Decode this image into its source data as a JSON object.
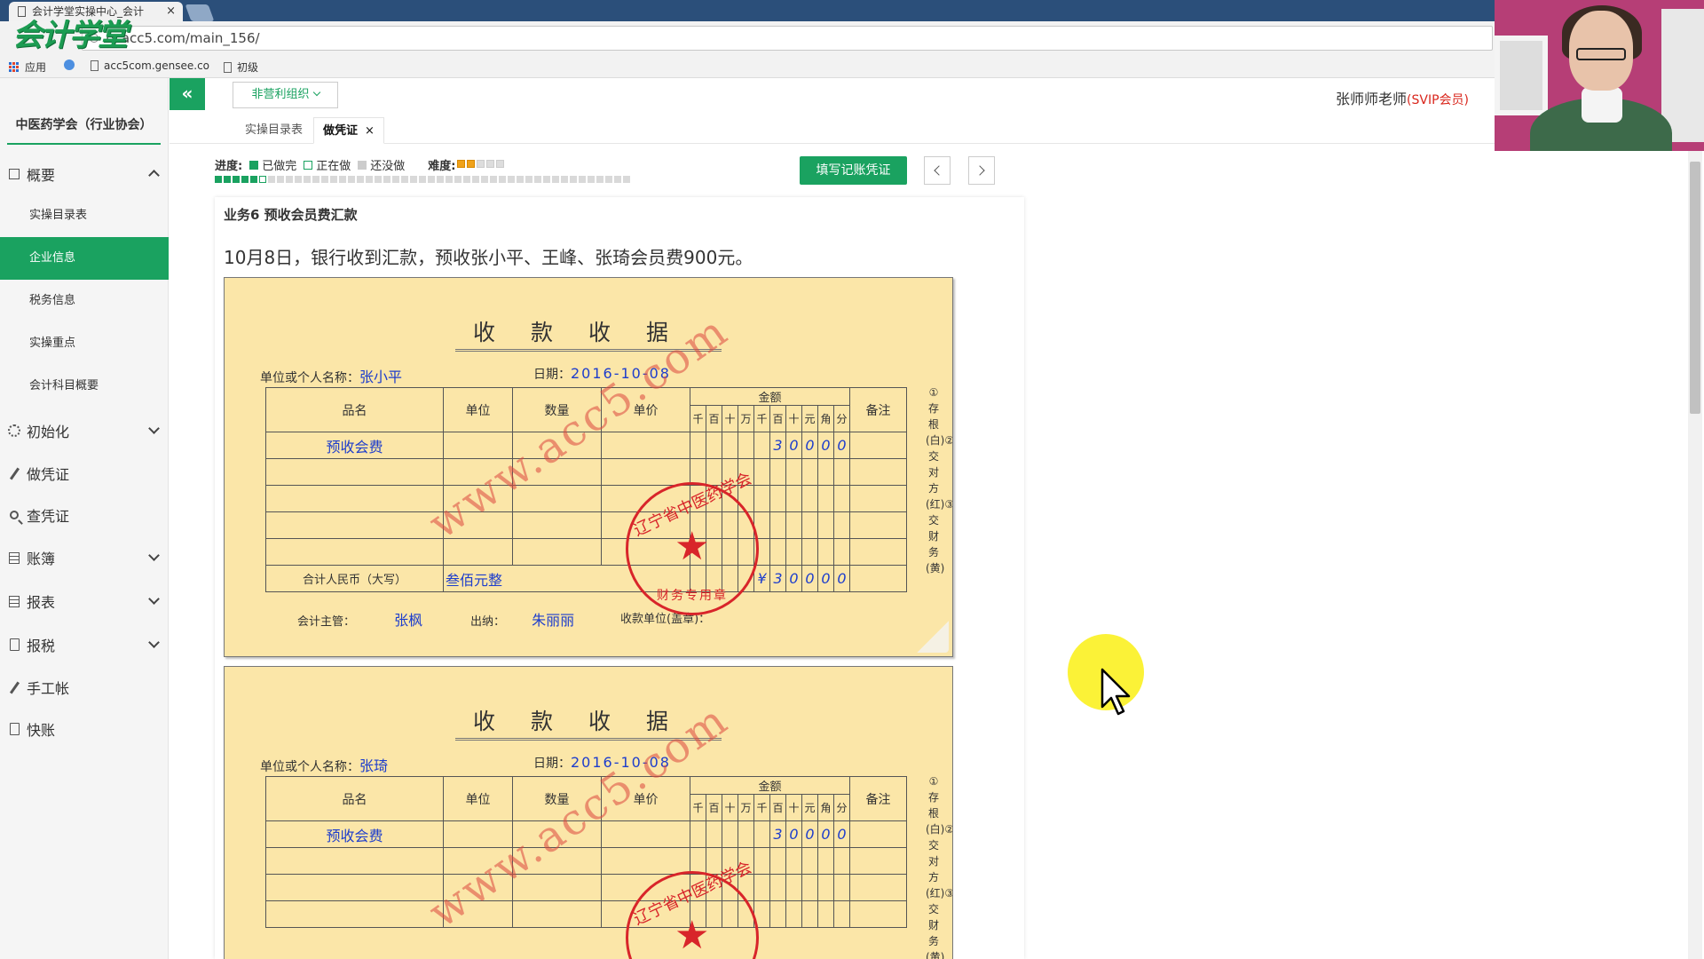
{
  "browser": {
    "tab_title": "会计学堂实操中心_会计",
    "url": "lx.acc5.com/main_156/",
    "logo_text": "会计学堂",
    "bookmarks": [
      "应用",
      "acc5com.gensee.co",
      "初级"
    ]
  },
  "sidebar": {
    "org_name": "中医药学会（行业协会）",
    "groups": [
      {
        "label": "概要",
        "icon": "dashboard-icon"
      },
      {
        "label": "初始化",
        "icon": "gear-icon"
      },
      {
        "label": "做凭证",
        "icon": "pen-icon"
      },
      {
        "label": "查凭证",
        "icon": "search-icon"
      },
      {
        "label": "账簿",
        "icon": "book-icon"
      },
      {
        "label": "报表",
        "icon": "report-icon"
      },
      {
        "label": "报税",
        "icon": "doc-icon"
      },
      {
        "label": "手工帐",
        "icon": "pen-icon"
      },
      {
        "label": "快账",
        "icon": "doc-icon"
      }
    ],
    "sub_items": [
      "实操目录表",
      "企业信息",
      "税务信息",
      "实操重点",
      "会计科目概要"
    ],
    "active_sub": "企业信息"
  },
  "topbar": {
    "collapse_glyph": "«",
    "org_type": "非营利组织",
    "user": "张师师老师",
    "vip": "(SVIP会员)"
  },
  "tabs": [
    {
      "label": "实操目录表"
    },
    {
      "label": "做凭证",
      "close": "×"
    }
  ],
  "progress": {
    "label": "进度:",
    "done": "已做完",
    "doing": "正在做",
    "todo": "还没做",
    "difficulty_label": "难度:",
    "difficulty_stars": 2,
    "difficulty_max": 5,
    "total_steps": 47,
    "done_steps": 5,
    "current_step": 6,
    "fill_button": "填写记账凭证"
  },
  "task": {
    "title": "业务6 预收会员费汇款",
    "description": "10月8日，银行收到汇款，预收张小平、王峰、张琦会员费900元。"
  },
  "receipt": {
    "title": "收款收据",
    "payer_label": "单位或个人名称：",
    "date_label": "日期：",
    "headers": [
      "品名",
      "单位",
      "数量",
      "单价",
      "金额",
      "备注"
    ],
    "digit_headers": [
      "千",
      "百",
      "十",
      "万",
      "千",
      "百",
      "十",
      "元",
      "角",
      "分"
    ],
    "total_label": "合计人民币（大写）",
    "total_words": "叁佰元整",
    "currency": "¥",
    "supervisor_label": "会计主管：",
    "cashier_label": "出纳：",
    "unit_label": "收款单位(盖章)：",
    "side_copies": "①存根(白)②交对方(红)③交财务(黄)",
    "watermark": "www.acc5.com",
    "seal_ring": "辽宁省中医药学会",
    "seal_bottom": "财务专用章",
    "seal_star": "★",
    "receipts": [
      {
        "payer": "张小平",
        "date": "2016-10-08",
        "item": "预收会费",
        "amount_digits": [
          "",
          "",
          "",
          "",
          "",
          "3",
          "0",
          "0",
          "0",
          "0"
        ],
        "total_digits": [
          "",
          "",
          "",
          "",
          "",
          "¥",
          "3",
          "0",
          "0",
          "0",
          "0"
        ],
        "supervisor": "张枫",
        "cashier": "朱丽丽"
      },
      {
        "payer": "张琦",
        "date": "2016-10-08",
        "item": "预收会费",
        "amount_digits": [
          "",
          "",
          "",
          "",
          "",
          "3",
          "0",
          "0",
          "0",
          "0"
        ]
      }
    ]
  },
  "colors": {
    "accent": "#1aa260",
    "vip": "#d9261c",
    "receipt_bg": "#fbe6a8",
    "seal": "#d8252a",
    "ink_blue": "#1d3dcc"
  }
}
